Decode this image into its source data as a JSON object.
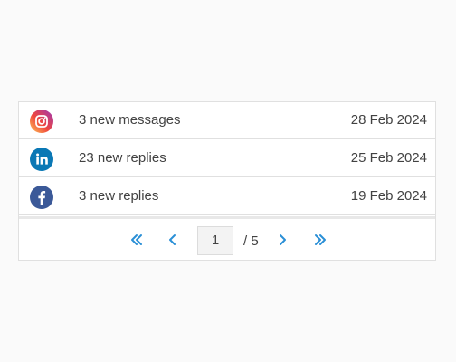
{
  "notifications": [
    {
      "icon": "instagram-icon",
      "message": "3 new messages",
      "date": "28 Feb 2024"
    },
    {
      "icon": "linkedin-icon",
      "message": "23 new replies",
      "date": "25 Feb 2024"
    },
    {
      "icon": "facebook-icon",
      "message": "3 new replies",
      "date": "19 Feb 2024"
    }
  ],
  "pagination": {
    "current_page": "1",
    "total_label": "/ 5",
    "first_icon": "double-chevron-left-icon",
    "prev_icon": "chevron-left-icon",
    "next_icon": "chevron-right-icon",
    "last_icon": "double-chevron-right-icon"
  },
  "colors": {
    "accent": "#2a8fd6",
    "linkedin": "#0a78b5",
    "facebook": "#3b5998",
    "text": "#424242",
    "border": "#e0e0e0"
  }
}
